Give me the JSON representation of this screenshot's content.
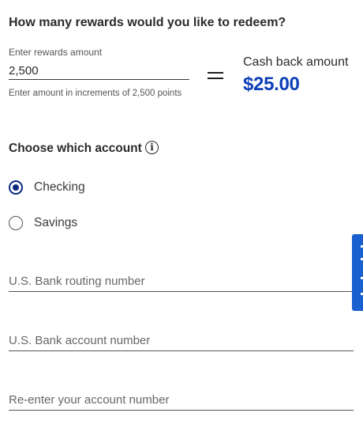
{
  "question": "How many rewards would you like to redeem?",
  "rewards": {
    "label": "Enter rewards amount",
    "value": "2,500",
    "hint": "Enter amount in increments of 2,500 points"
  },
  "cash_back": {
    "label": "Cash back amount",
    "value": "$25.00"
  },
  "account": {
    "heading": "Choose which account",
    "options": [
      {
        "label": "Checking",
        "selected": true
      },
      {
        "label": "Savings",
        "selected": false
      }
    ]
  },
  "fields": {
    "routing_placeholder": "U.S. Bank routing number",
    "account_placeholder": "U.S. Bank account number",
    "reenter_placeholder": "Re-enter your account number"
  },
  "colors": {
    "accent": "#0c3fb8",
    "radio_selected": "#0a2a7d",
    "feedback_tab": "#1a5fd0"
  }
}
